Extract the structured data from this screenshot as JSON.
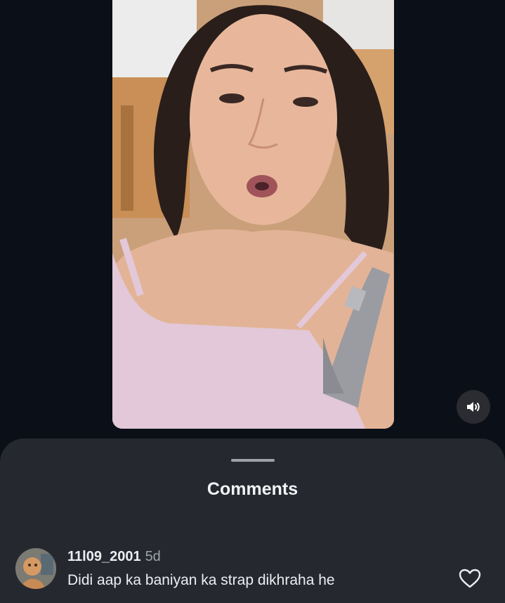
{
  "video": {
    "sound_icon": "speaker-icon"
  },
  "comments_sheet": {
    "title": "Comments",
    "comments": [
      {
        "username": "11l09_2001",
        "time": "5d",
        "text": "Didi aap ka baniyan ka strap dikhraha he",
        "avatar_icon": "avatar-photo",
        "like_icon": "heart-outline-icon"
      }
    ]
  },
  "colors": {
    "background": "#0b0f17",
    "sheet": "#25292f",
    "text": "#eceef1",
    "muted": "#9ea3aa"
  }
}
